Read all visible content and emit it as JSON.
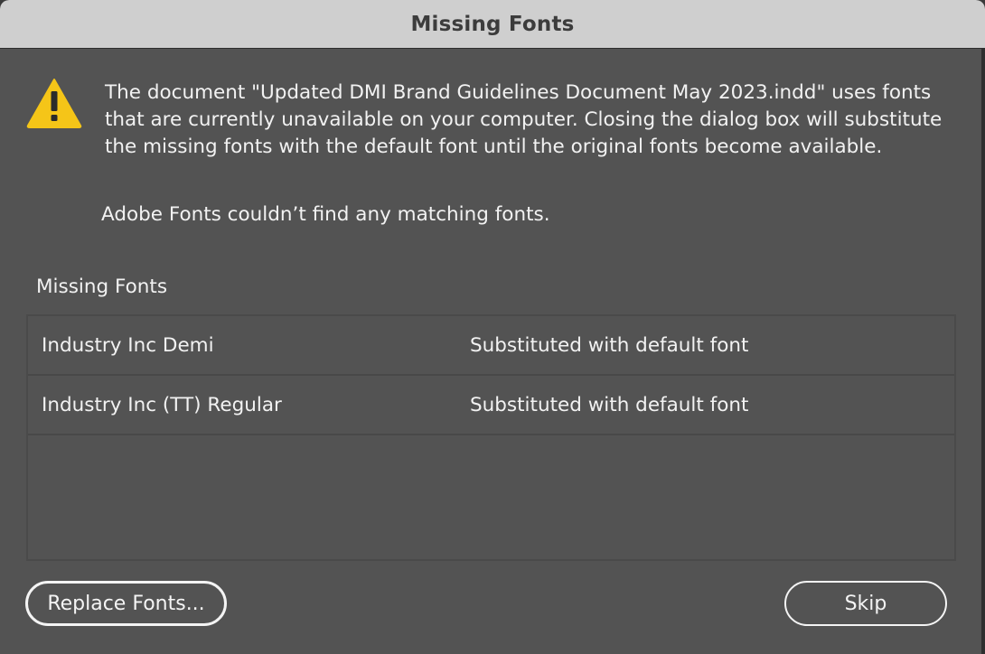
{
  "dialog": {
    "title": "Missing Fonts",
    "icon": "warning-icon",
    "message": "The document \"Updated DMI Brand Guidelines Document May 2023.indd\" uses fonts that are currently unavailable on your computer. Closing the dialog box will substitute the missing fonts with the default font until the original fonts become available.",
    "adobe_fonts_note": "Adobe Fonts couldn’t find any matching fonts.",
    "section_label": "Missing Fonts",
    "fonts": [
      {
        "name": "Industry Inc Demi",
        "status": "Substituted with default font"
      },
      {
        "name": "Industry Inc (TT) Regular",
        "status": "Substituted with default font"
      }
    ],
    "buttons": {
      "replace_label": "Replace Fonts...",
      "skip_label": "Skip"
    },
    "colors": {
      "background": "#535353",
      "titlebar": "#cfcfcf",
      "warning_yellow": "#f5c518",
      "text": "#f2f2f2"
    }
  }
}
